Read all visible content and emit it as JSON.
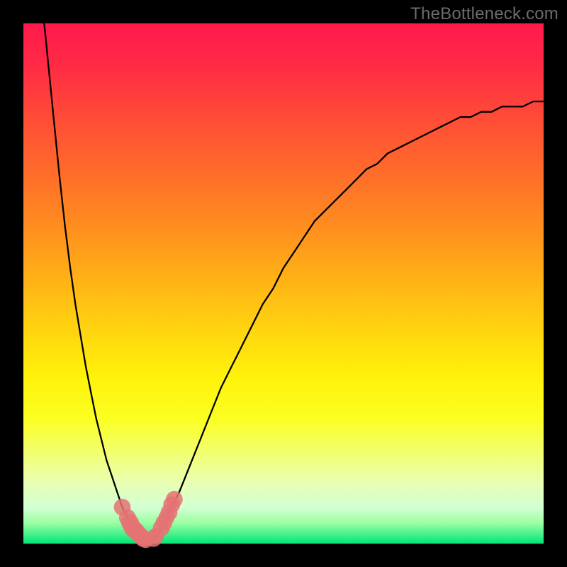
{
  "watermark": "TheBottleneck.com",
  "colors": {
    "frame": "#000000",
    "curve": "#000000",
    "marker": "#e57373",
    "gradient_stops": [
      "#ff1a4d",
      "#ff2a45",
      "#ff4b37",
      "#ff6a2b",
      "#ff8a20",
      "#ffad17",
      "#ffd110",
      "#fff20a",
      "#fbff22",
      "#f3ff6a",
      "#e9ffb0",
      "#d4ffd4",
      "#9cffa4",
      "#00e676"
    ]
  },
  "chart_data": {
    "type": "line",
    "title": "",
    "xlabel": "",
    "ylabel": "",
    "xlim": [
      0,
      100
    ],
    "ylim": [
      0,
      100
    ],
    "x": [
      4,
      5,
      6,
      7,
      8,
      9,
      10,
      11,
      12,
      13,
      14,
      15,
      16,
      17,
      18,
      19,
      20,
      21,
      22,
      23,
      24,
      25,
      26,
      27,
      28,
      30,
      32,
      34,
      36,
      38,
      40,
      42,
      44,
      46,
      48,
      50,
      52,
      54,
      56,
      58,
      60,
      62,
      64,
      66,
      68,
      70,
      72,
      74,
      76,
      78,
      80,
      82,
      84,
      86,
      88,
      90,
      92,
      94,
      96,
      98,
      100
    ],
    "series": [
      {
        "name": "bottleneck-curve",
        "values": [
          100,
          90,
          80,
          70,
          61,
          53,
          46,
          40,
          34,
          29,
          24,
          20,
          16,
          13,
          10,
          7,
          5,
          3,
          2,
          1,
          0,
          1,
          2,
          4,
          6,
          10,
          15,
          20,
          25,
          30,
          34,
          38,
          42,
          46,
          49,
          53,
          56,
          59,
          62,
          64,
          66,
          68,
          70,
          72,
          73,
          75,
          76,
          77,
          78,
          79,
          80,
          81,
          82,
          82,
          83,
          83,
          84,
          84,
          84,
          85,
          85
        ]
      }
    ],
    "markers": [
      {
        "x": 19,
        "y": 7,
        "r": 1.2
      },
      {
        "x": 20,
        "y": 5,
        "r": 1.2
      },
      {
        "x": 20.5,
        "y": 4,
        "r": 1.3
      },
      {
        "x": 21,
        "y": 3,
        "r": 1.3
      },
      {
        "x": 21.5,
        "y": 2.5,
        "r": 1.3
      },
      {
        "x": 22,
        "y": 2,
        "r": 1.2
      },
      {
        "x": 22.5,
        "y": 1.5,
        "r": 1.2
      },
      {
        "x": 23,
        "y": 1,
        "r": 1.2
      },
      {
        "x": 23.5,
        "y": 0.7,
        "r": 1.1
      },
      {
        "x": 25,
        "y": 1,
        "r": 1.2
      },
      {
        "x": 25.5,
        "y": 1.5,
        "r": 1.1
      },
      {
        "x": 26.5,
        "y": 3,
        "r": 1.2
      },
      {
        "x": 27,
        "y": 4,
        "r": 1.2
      },
      {
        "x": 27.5,
        "y": 5,
        "r": 1.1
      },
      {
        "x": 28,
        "y": 6,
        "r": 1.2
      },
      {
        "x": 28.5,
        "y": 7.5,
        "r": 1.2
      },
      {
        "x": 29,
        "y": 8.5,
        "r": 1.2
      }
    ],
    "legend": "none",
    "grid": false
  }
}
